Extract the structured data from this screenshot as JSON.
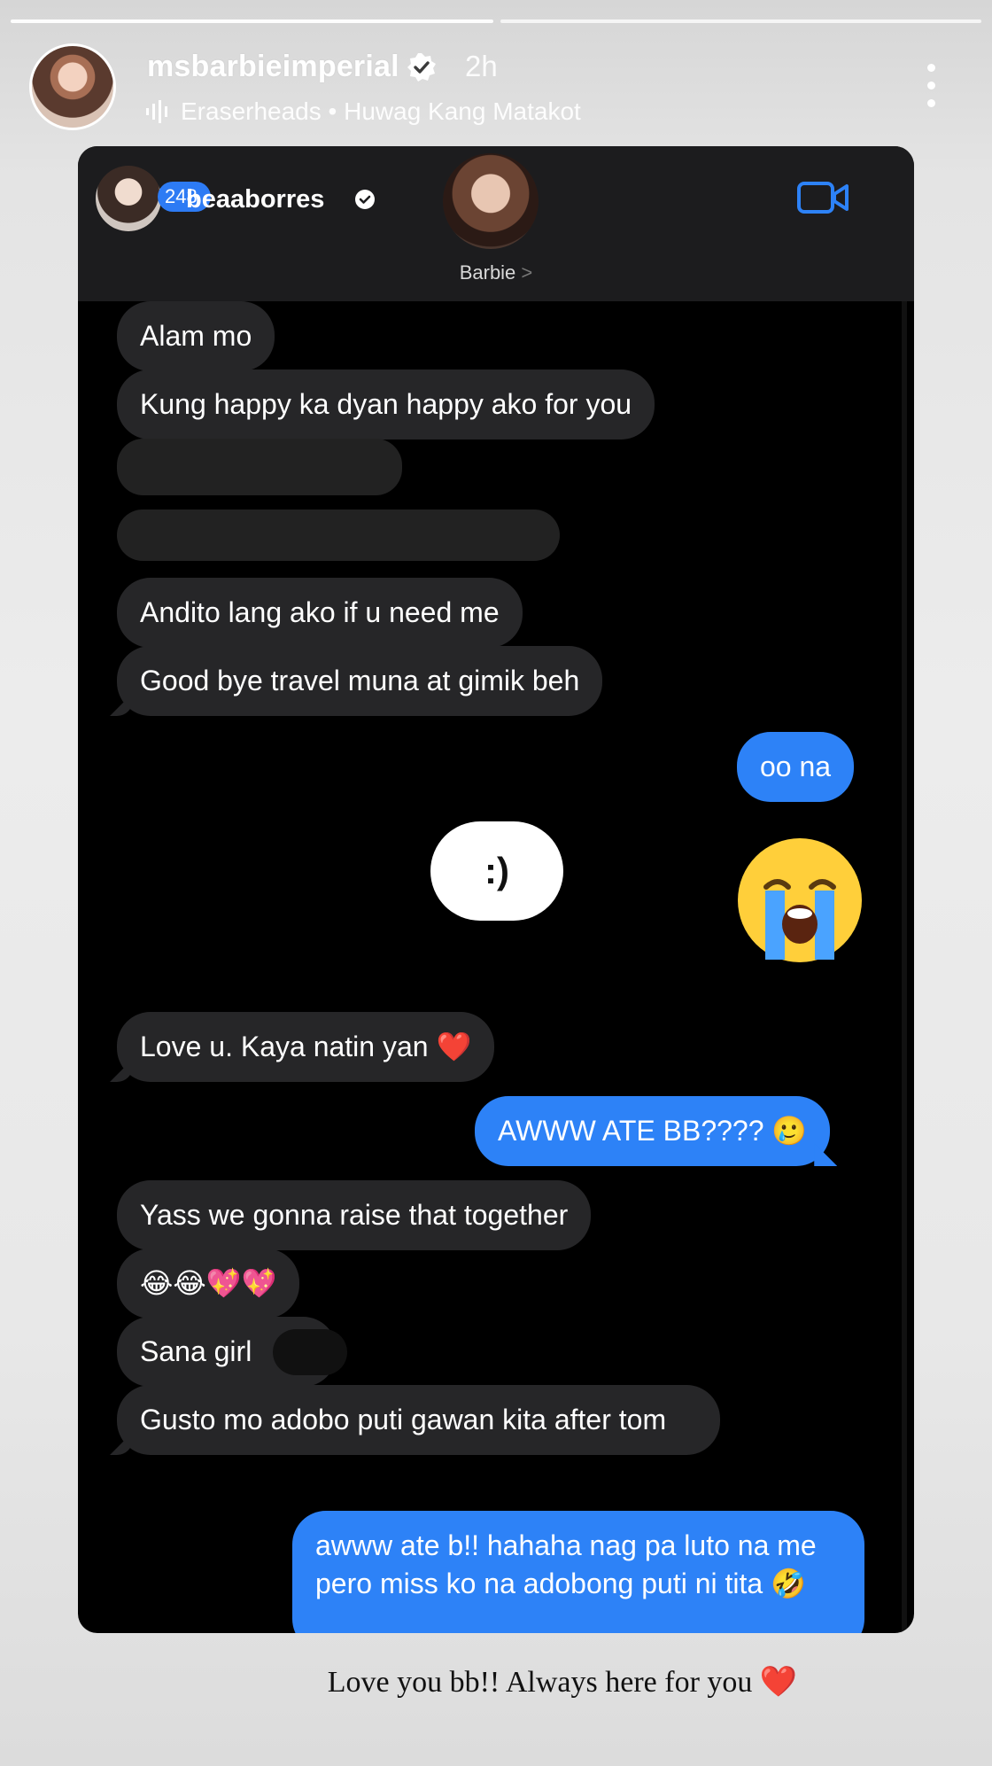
{
  "story": {
    "username": "msbarbieimperial",
    "time": "2h",
    "music": "Eraserheads • Huwag Kang Matakot",
    "caption": "Love you bb!! Always here for you ❤️"
  },
  "chat": {
    "header_name": "beaaborres",
    "unread_count": "248",
    "contact_name": "Barbie",
    "contact_chevron": ">",
    "messages": [
      {
        "dir": "in",
        "text": "Alam mo"
      },
      {
        "dir": "in",
        "text": "Kung happy ka dyan happy ako for you"
      },
      {
        "dir": "in",
        "text": "Andito lang ako if u need me"
      },
      {
        "dir": "in",
        "text": "Good bye travel muna at gimik beh"
      },
      {
        "dir": "out",
        "text": "oo na"
      },
      {
        "dir": "in",
        "text": ":)"
      },
      {
        "dir": "out",
        "text": "😭"
      },
      {
        "dir": "in",
        "text": "Love u. Kaya natin yan ❤️"
      },
      {
        "dir": "out",
        "text": "AWWW ATE BB???? 🥲"
      },
      {
        "dir": "in",
        "text": "Yass we gonna raise that together"
      },
      {
        "dir": "in",
        "text": "😂😂💖💖"
      },
      {
        "dir": "in",
        "text": "Sana girl"
      },
      {
        "dir": "in",
        "text": "Gusto mo adobo puti gawan kita after tom"
      },
      {
        "dir": "out",
        "text": "awww ate b!! hahaha nag pa luto na me pero miss ko na adobong puti ni tita 🤣"
      }
    ]
  },
  "colors": {
    "incoming_bubble": "#262628",
    "outgoing_bubble": "#2d82f7",
    "verified": "#ffffff",
    "heart": "#e02424"
  },
  "icons": [
    "verified-badge-icon",
    "music-bars-icon",
    "more-vertical-icon",
    "video-call-icon",
    "chevron-right-icon"
  ]
}
